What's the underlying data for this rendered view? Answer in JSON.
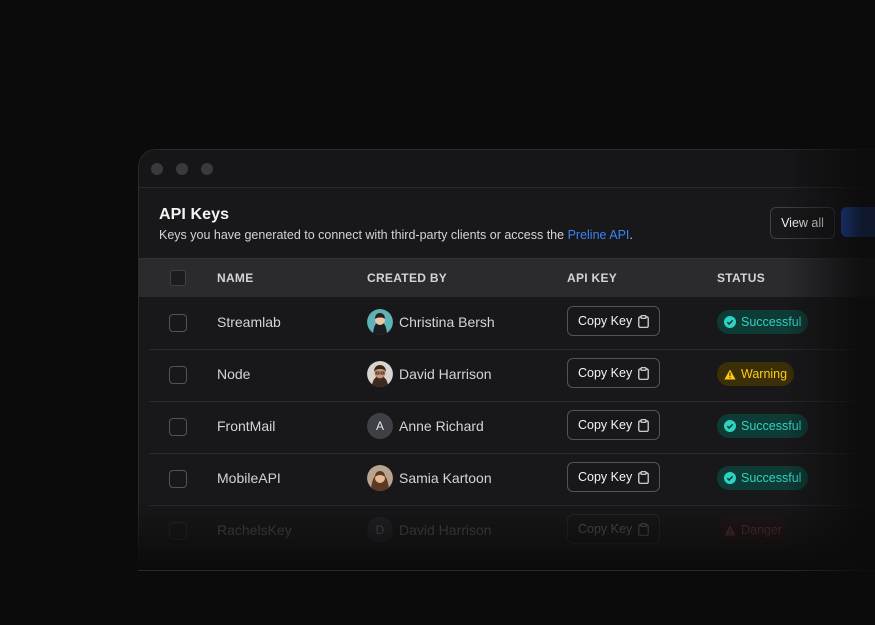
{
  "header": {
    "title": "API Keys",
    "subtitle_text": "Keys you have generated to connect with third-party clients or access the",
    "subtitle_link": "Preline API",
    "subtitle_end": ".",
    "view_all_label": "View all"
  },
  "table": {
    "columns": {
      "name": "NAME",
      "created_by": "CREATED BY",
      "api_key": "API KEY",
      "status": "STATUS"
    },
    "rows": [
      {
        "name": "Streamlab",
        "creator": "Christina Bersh",
        "avatar": "photo",
        "copy_label": "Copy Key",
        "status": "Successful",
        "status_type": "success"
      },
      {
        "name": "Node",
        "creator": "David Harrison",
        "avatar": "photo",
        "copy_label": "Copy Key",
        "status": "Warning",
        "status_type": "warning"
      },
      {
        "name": "FrontMail",
        "creator": "Anne Richard",
        "avatar_initial": "A",
        "copy_label": "Copy Key",
        "status": "Successful",
        "status_type": "success"
      },
      {
        "name": "MobileAPI",
        "creator": "Samia Kartoon",
        "avatar": "photo",
        "copy_label": "Copy Key",
        "status": "Successful",
        "status_type": "success"
      },
      {
        "name": "RachelsKey",
        "creator": "David Harrison",
        "avatar_initial": "D",
        "copy_label": "Copy Key",
        "status": "Danger",
        "status_type": "danger"
      }
    ]
  },
  "colors": {
    "accent": "#2563eb",
    "link": "#3b82f6",
    "success": "#2dd4bf",
    "warning": "#facc15",
    "danger": "#f87171"
  }
}
